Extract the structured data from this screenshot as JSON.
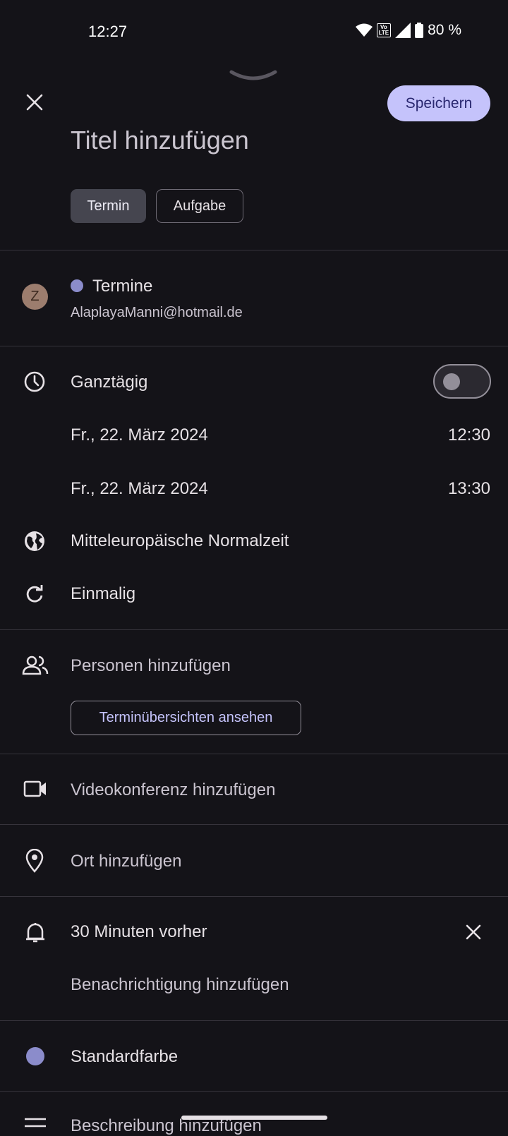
{
  "status_bar": {
    "time": "12:27",
    "volte_top": "Vo",
    "volte_bottom": "LTE",
    "battery": "80 %"
  },
  "header": {
    "save_label": "Speichern",
    "title_placeholder": "Titel hinzufügen"
  },
  "type_chips": [
    {
      "label": "Termin",
      "selected": true
    },
    {
      "label": "Aufgabe",
      "selected": false
    }
  ],
  "calendar": {
    "avatar_letter": "Z",
    "name": "Termine",
    "account": "AlaplayaManni@hotmail.de",
    "color": "#8b8ccb"
  },
  "datetime": {
    "all_day_label": "Ganztägig",
    "all_day_on": false,
    "start_date": "Fr., 22. März 2024",
    "start_time": "12:30",
    "end_date": "Fr., 22. März 2024",
    "end_time": "13:30",
    "timezone": "Mitteleuropäische Normalzeit",
    "repeat": "Einmalig"
  },
  "people": {
    "label": "Personen hinzufügen",
    "schedule_button": "Terminübersichten ansehen"
  },
  "video": {
    "label": "Videokonferenz hinzufügen"
  },
  "location": {
    "label": "Ort hinzufügen"
  },
  "notifications": {
    "current": "30 Minuten vorher",
    "add_label": "Benachrichtigung hinzufügen"
  },
  "color": {
    "label": "Standardfarbe",
    "value": "#8b8ccb"
  },
  "description": {
    "label": "Beschreibung hinzufügen"
  },
  "theme": {
    "accent": "#c5c3fb",
    "background": "#141318"
  }
}
